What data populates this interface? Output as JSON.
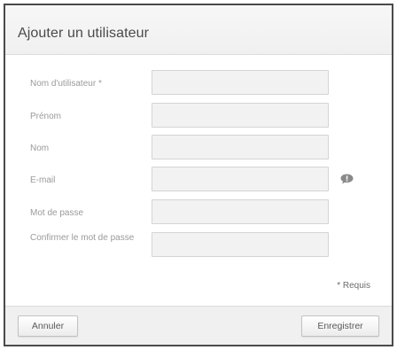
{
  "dialog": {
    "title": "Ajouter un utilisateur"
  },
  "form": {
    "username": {
      "label": "Nom d'utilisateur *",
      "value": ""
    },
    "first_name": {
      "label": "Prénom",
      "value": ""
    },
    "last_name": {
      "label": "Nom",
      "value": ""
    },
    "email": {
      "label": "E-mail",
      "value": "",
      "help_icon": "speech-bubble-icon"
    },
    "password": {
      "label": "Mot de passe",
      "value": ""
    },
    "confirm_password": {
      "label": "Confirmer le mot de passe",
      "value": ""
    }
  },
  "required_note": "* Requis",
  "footer": {
    "cancel_label": "Annuler",
    "save_label": "Enregistrer"
  },
  "colors": {
    "border": "#4a4a4a",
    "field_bg": "#f2f2f2",
    "label": "#9a9a9a"
  }
}
